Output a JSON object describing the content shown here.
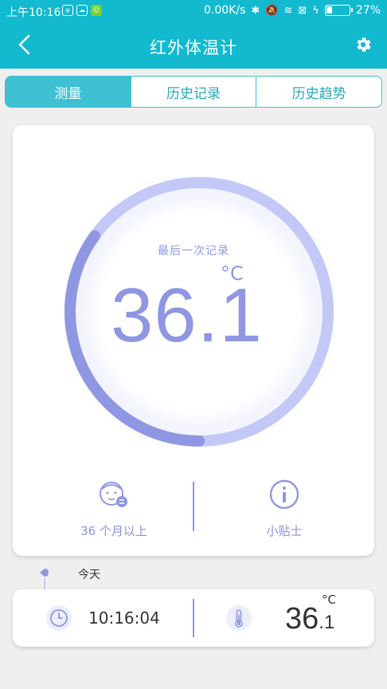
{
  "status_bar": {
    "time": "上午10:16",
    "speed": "0.00K/s",
    "battery_percent": "27%",
    "battery_level": 0.27
  },
  "header": {
    "title": "红外体温计",
    "back_icon": "chevron-left-icon",
    "settings_icon": "gear-icon"
  },
  "tabs": [
    {
      "label": "测量",
      "active": true
    },
    {
      "label": "历史记录",
      "active": false
    },
    {
      "label": "历史趋势",
      "active": false
    }
  ],
  "measure": {
    "caption": "最后一次记录",
    "unit": "°C",
    "value": "36.1",
    "value_int": "36",
    "value_dec": ".1",
    "gauge_fill_fraction": 0.35,
    "age_group": "36 个月以上",
    "tips_label": "小贴士",
    "colors": {
      "accent": "#8f97e3",
      "track": "#c3c8f6",
      "header": "#12b9cf"
    }
  },
  "history": {
    "day_label": "今天",
    "records": [
      {
        "time": "10:16:04",
        "unit": "°C",
        "value_int": "36",
        "value_dec": ".1"
      }
    ]
  }
}
